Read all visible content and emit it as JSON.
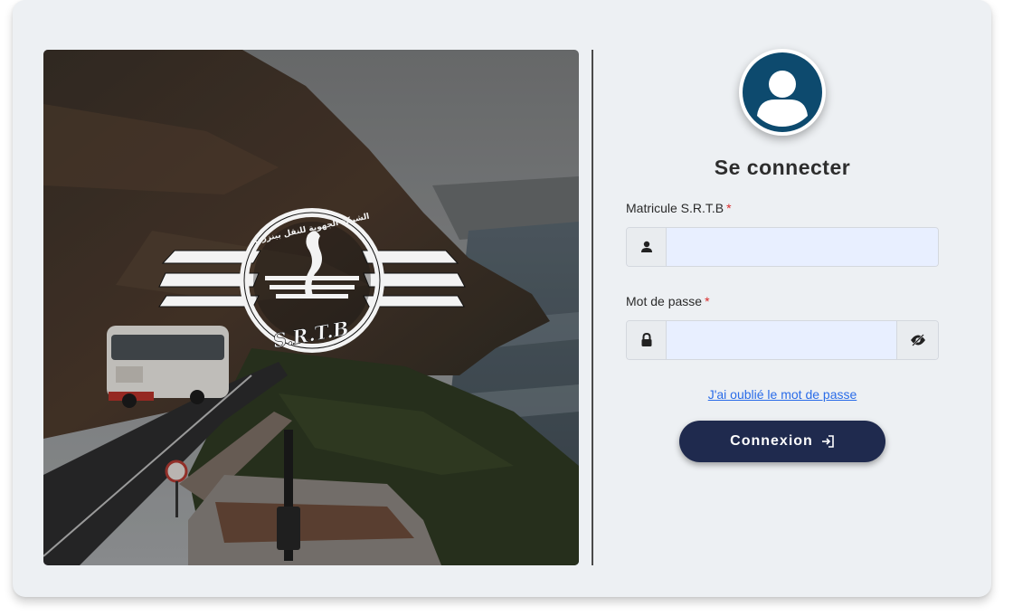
{
  "login": {
    "title": "Se connecter",
    "matricule_label": "Matricule S.R.T.B",
    "matricule_value": "",
    "password_label": "Mot de passe",
    "password_value": "",
    "required_mark": "*",
    "forgot_link": "J'ai oublié le mot de passe",
    "submit_label": "Connexion"
  },
  "logo": {
    "text": "S.R.T.B",
    "arabic_text": "الشركة الجهوية للنقل ببنزرت"
  },
  "icons": {
    "avatar": "user-circle-icon",
    "matricule": "user-icon",
    "password": "lock-icon",
    "toggle": "eye-slash-icon",
    "submit": "sign-in-icon"
  },
  "colors": {
    "card_bg": "#edf0f3",
    "avatar_bg": "#0d4a6e",
    "button_bg": "#1f2a4e",
    "link": "#2a6ce8",
    "required": "#d92b2b",
    "input_bg": "#e8efff"
  }
}
